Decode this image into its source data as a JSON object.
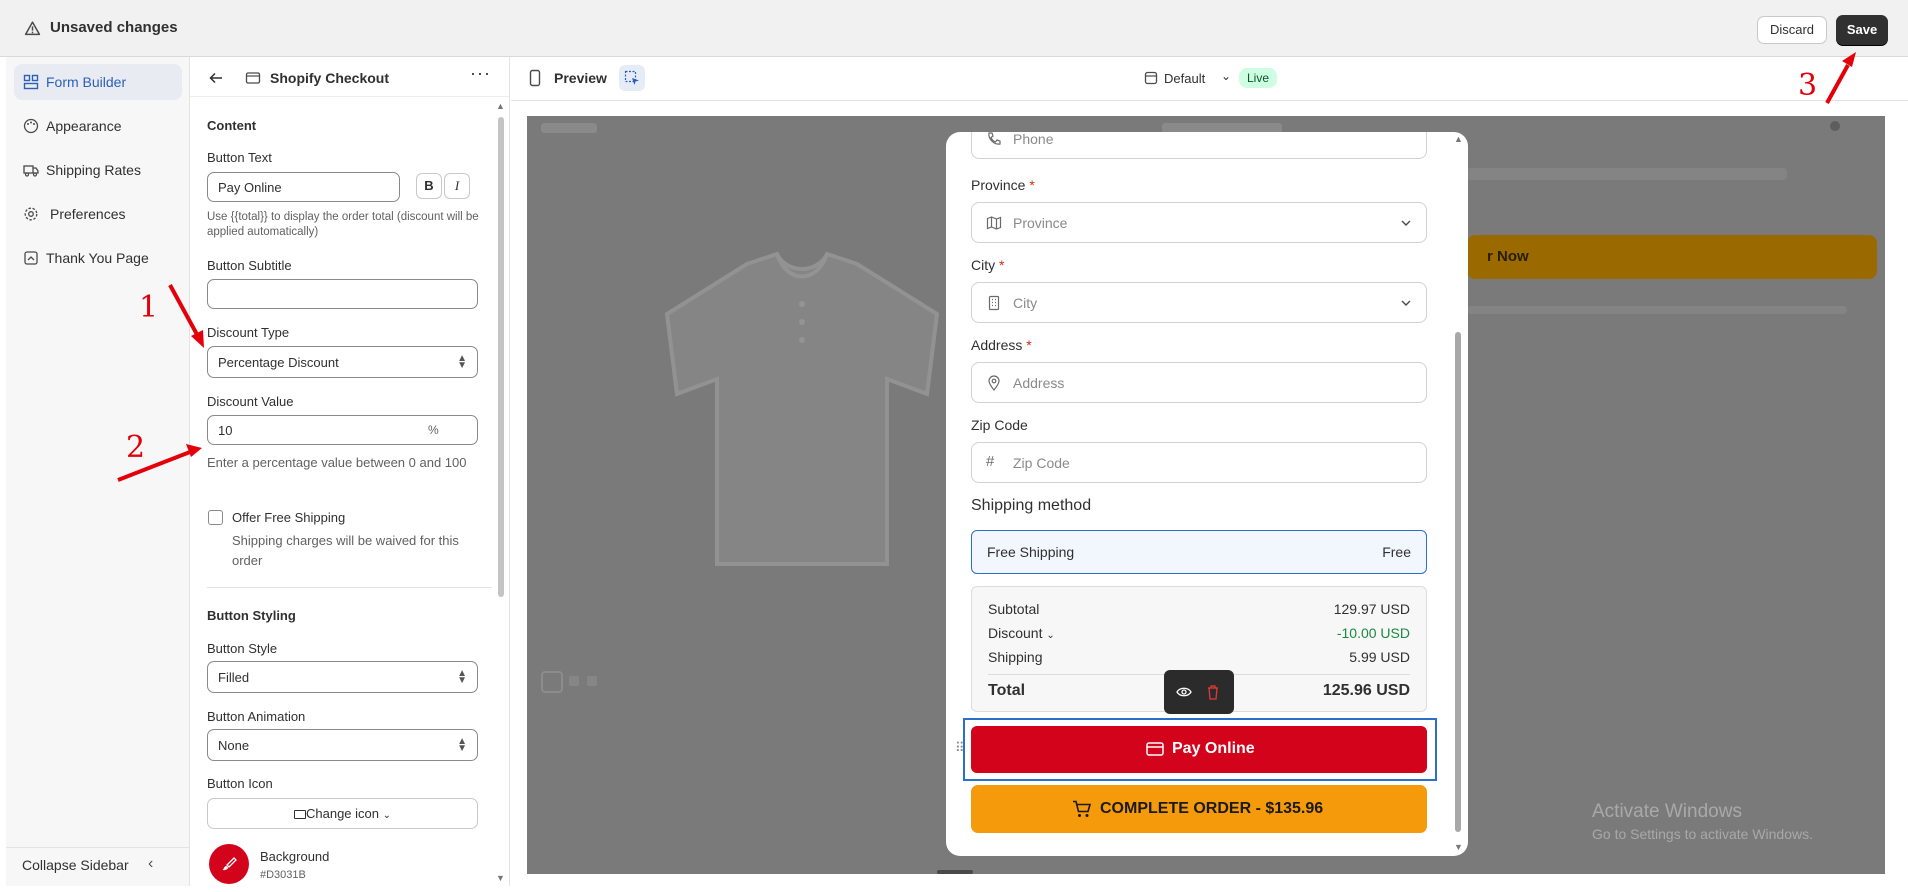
{
  "topbar": {
    "status": "Unsaved changes",
    "discard_label": "Discard",
    "save_label": "Save"
  },
  "nav": {
    "items": [
      {
        "label": "Form Builder",
        "icon": "form-icon",
        "active": true
      },
      {
        "label": "Appearance",
        "icon": "palette-icon",
        "active": false
      },
      {
        "label": "Shipping Rates",
        "icon": "truck-icon",
        "active": false
      },
      {
        "label": "Preferences",
        "icon": "gear-icon",
        "active": false
      },
      {
        "label": "Thank You Page",
        "icon": "page-icon",
        "active": false
      }
    ],
    "collapse_label": "Collapse Sidebar"
  },
  "panel": {
    "title": "Shopify Checkout",
    "content_heading": "Content",
    "button_text_label": "Button Text",
    "button_text_value": "Pay Online",
    "bold_label": "B",
    "italic_label": "I",
    "button_text_help": "Use {{total}} to display the order total (discount will be applied automatically)",
    "button_subtitle_label": "Button Subtitle",
    "button_subtitle_value": "",
    "discount_type_label": "Discount Type",
    "discount_type_value": "Percentage Discount",
    "discount_value_label": "Discount Value",
    "discount_value": "10",
    "discount_suffix": "%",
    "discount_help": "Enter a percentage value between 0 and 100",
    "free_shipping_label": "Offer Free Shipping",
    "free_shipping_help": "Shipping charges will be waived for this order",
    "styling_heading": "Button Styling",
    "button_style_label": "Button Style",
    "button_style_value": "Filled",
    "button_animation_label": "Button Animation",
    "button_animation_value": "None",
    "button_icon_label": "Button Icon",
    "change_icon_label": "Change icon",
    "background_label": "Background",
    "background_value": "#D3031B"
  },
  "preview": {
    "label": "Preview",
    "theme_select": "Default",
    "live_badge": "Live",
    "form": {
      "phone_placeholder": "Phone",
      "province_label": "Province",
      "province_placeholder": "Province",
      "city_label": "City",
      "city_placeholder": "City",
      "address_label": "Address",
      "address_placeholder": "Address",
      "zip_label": "Zip Code",
      "zip_placeholder": "Zip Code",
      "required_mark": "*",
      "shipping_heading": "Shipping method",
      "shipping_option": "Free Shipping",
      "shipping_option_price": "Free",
      "subtotal_label": "Subtotal",
      "subtotal_value": "129.97 USD",
      "discount_label": "Discount",
      "discount_value": "-10.00 USD",
      "shipping_label": "Shipping",
      "shipping_value": "5.99 USD",
      "total_label": "Total",
      "total_value": "125.96 USD",
      "pay_button": "Pay Online",
      "complete_button": "COMPLETE ORDER - $135.96"
    },
    "background_button_partial": "r Now"
  },
  "annotations": [
    "1",
    "2",
    "3"
  ],
  "watermark": {
    "line1": "Activate Windows",
    "line2": "Go to Settings to activate Windows."
  },
  "colors": {
    "pay_button": "#D3031B",
    "complete_button": "#F59A0B",
    "accent": "#2C6ECB",
    "discount_green": "#1A8A3E",
    "annotation_red": "#E3000B"
  }
}
